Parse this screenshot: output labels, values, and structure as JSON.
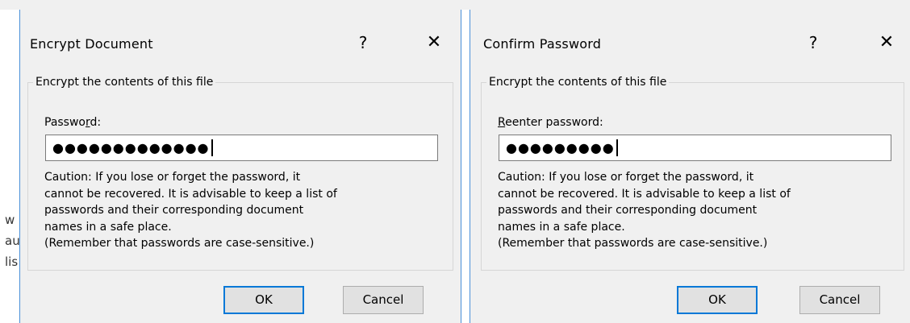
{
  "background_document": {
    "fragments": [
      "w",
      "au",
      "lis"
    ]
  },
  "dialogs": [
    {
      "title": "Encrypt Document",
      "help_glyph": "?",
      "close_glyph": "✕",
      "group_title": "Encrypt the contents of this file",
      "field_label_pre": "Passwo",
      "field_label_accel": "r",
      "field_label_post": "d:",
      "input_value": "●●●●●●●●●●●●●",
      "caution": "Caution: If you lose or forget the password, it\ncannot be recovered. It is advisable to keep a list of\npasswords and their corresponding document\nnames in a safe place.\n(Remember that passwords are case-sensitive.)",
      "ok_label": "OK",
      "cancel_label": "Cancel"
    },
    {
      "title": "Confirm Password",
      "help_glyph": "?",
      "close_glyph": "✕",
      "group_title": "Encrypt the contents of this file",
      "field_label_accel": "R",
      "field_label_post": "eenter password:",
      "input_value": "●●●●●●●●●",
      "caution": "Caution: If you lose or forget the password, it\ncannot be recovered. It is advisable to keep a list of\npasswords and their corresponding document\nnames in a safe place.\n(Remember that passwords are case-sensitive.)",
      "ok_label": "OK",
      "cancel_label": "Cancel"
    }
  ],
  "colors": {
    "dialog_bg": "#f0f0f0",
    "accent_border": "#0078d7",
    "input_bg": "#ffffff"
  }
}
